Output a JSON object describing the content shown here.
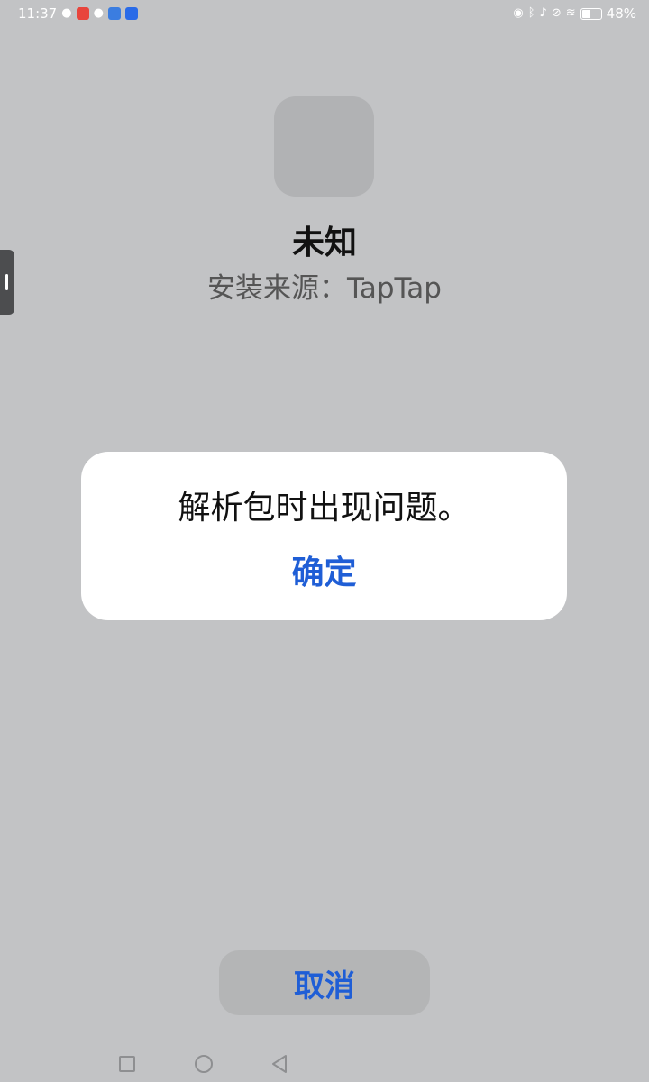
{
  "status_bar": {
    "time": "11:37",
    "battery_percent": "48%",
    "battery_level": 0.48,
    "left_icons": [
      "wechat-icon",
      "app-red-icon",
      "wechat-icon",
      "app-blue-icon",
      "app-bolt-icon"
    ],
    "right_icons": [
      "eye-icon",
      "bluetooth-icon",
      "mic-icon",
      "mute-icon",
      "wifi-icon",
      "battery-icon"
    ]
  },
  "app": {
    "name": "未知",
    "install_source": "安装来源：TapTap"
  },
  "dialog": {
    "message": "解析包时出现问题。",
    "ok_label": "确定"
  },
  "footer": {
    "cancel_label": "取消"
  },
  "colors": {
    "accent": "#1f5ed6",
    "background": "#c2c3c5"
  }
}
